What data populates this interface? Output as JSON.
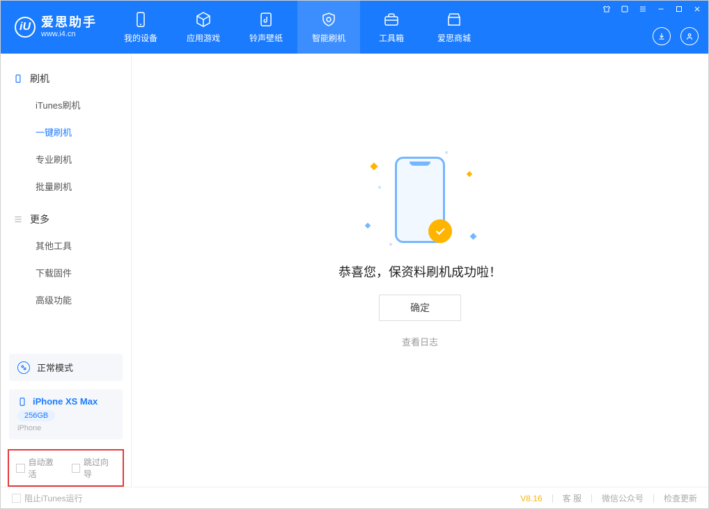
{
  "app": {
    "title": "爱思助手",
    "subtitle": "www.i4.cn"
  },
  "nav": {
    "device": "我的设备",
    "apps": "应用游戏",
    "ringtones": "铃声壁纸",
    "flash": "智能刷机",
    "toolbox": "工具箱",
    "store": "爱思商城"
  },
  "sidebar": {
    "group_flash": "刷机",
    "items_flash": {
      "itunes": "iTunes刷机",
      "onekey": "一键刷机",
      "pro": "专业刷机",
      "batch": "批量刷机"
    },
    "group_more": "更多",
    "items_more": {
      "other": "其他工具",
      "firmware": "下载固件",
      "advanced": "高级功能"
    }
  },
  "device": {
    "mode": "正常模式",
    "name": "iPhone XS Max",
    "storage": "256GB",
    "type": "iPhone"
  },
  "options": {
    "auto_activate": "自动激活",
    "skip_guide": "跳过向导"
  },
  "main": {
    "success": "恭喜您，保资料刷机成功啦！",
    "ok": "确定",
    "view_log": "查看日志"
  },
  "footer": {
    "block_itunes": "阻止iTunes运行",
    "version": "V8.16",
    "support": "客 服",
    "wechat": "微信公众号",
    "update": "检查更新"
  }
}
